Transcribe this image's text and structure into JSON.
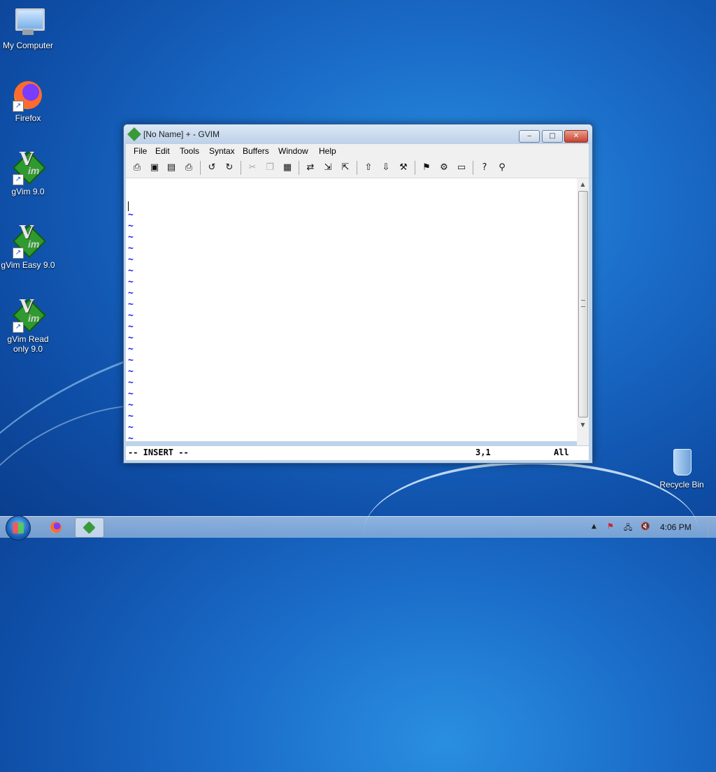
{
  "desktop": {
    "icons": [
      {
        "label": "My Computer"
      },
      {
        "label": "Firefox"
      },
      {
        "label": "gVim 9.0"
      },
      {
        "label": "gVim Easy 9.0"
      },
      {
        "label": "gVim Read only 9.0"
      },
      {
        "label": "Recycle Bin"
      }
    ]
  },
  "window": {
    "title": "[No Name] + - GVIM",
    "controls": {
      "minimize": "‒",
      "maximize": "□",
      "close": "✕"
    }
  },
  "menu": [
    "File",
    "Edit",
    "Tools",
    "Syntax",
    "Buffers",
    "Window",
    "Help"
  ],
  "toolbar": {
    "icons": [
      "open-icon",
      "save-icon",
      "save-all-icon",
      "print-icon",
      "undo-icon",
      "redo-icon",
      "cut-icon",
      "copy-icon",
      "paste-icon",
      "replace-icon",
      "find-next-icon",
      "find-prev-icon",
      "load-session-icon",
      "save-session-icon",
      "run-script-icon",
      "make-icon",
      "run-ctags-icon",
      "jump-tag-icon",
      "help-icon",
      "find-help-icon"
    ]
  },
  "editor": {
    "tilde": "~",
    "tilde_count": 21
  },
  "status": {
    "mode": "-- INSERT --",
    "position": "3,1",
    "scroll": "All"
  },
  "taskbar": {
    "clock": "4:06 PM"
  },
  "colors": {
    "tilde": "#1a1aee",
    "desktop": "#1a6cc8",
    "close_button": "#c8412c"
  }
}
